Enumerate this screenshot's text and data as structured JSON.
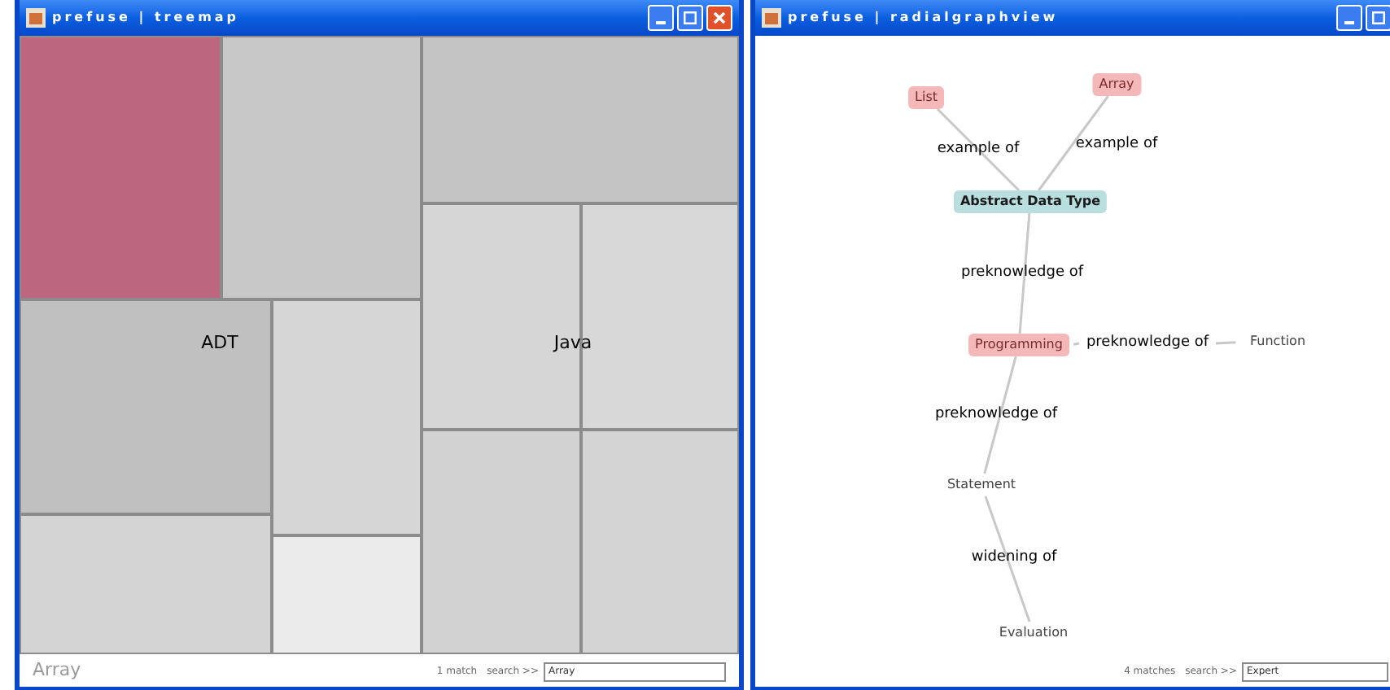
{
  "treemap_window": {
    "title": "prefuse | treemap",
    "cells": [
      {
        "color": "#bc6680"
      },
      {
        "color": "#c8c8c8"
      },
      {
        "color": "#c4c4c4"
      },
      {
        "color": "#c0c0c0"
      },
      {
        "color": "#d6d6d6"
      },
      {
        "color": "#d4d4d4"
      },
      {
        "color": "#ebebeb"
      },
      {
        "color": "#d6d6d6"
      },
      {
        "color": "#d8d8d8"
      },
      {
        "color": "#d2d2d2"
      },
      {
        "color": "#d4d4d4"
      }
    ],
    "group_labels": [
      "ADT",
      "Java"
    ],
    "status": {
      "hover_text": "Array",
      "match_count": "1 match",
      "search_label": "search >>",
      "search_value": "Array"
    }
  },
  "graph_window": {
    "title": "prefuse | radialgraphview",
    "nodes": [
      {
        "label": "List",
        "kind": "match"
      },
      {
        "label": "Array",
        "kind": "match"
      },
      {
        "label": "Abstract Data Type",
        "kind": "focus"
      },
      {
        "label": "Programming",
        "kind": "match"
      },
      {
        "label": "Function",
        "kind": "plain"
      },
      {
        "label": "Statement",
        "kind": "plain"
      },
      {
        "label": "Evaluation",
        "kind": "plain"
      }
    ],
    "edge_labels": [
      "example of",
      "example of",
      "preknowledge of",
      "preknowledge of",
      "preknowledge of",
      "widening of"
    ],
    "status": {
      "match_count": "4 matches",
      "search_label": "search >>",
      "search_value": "Expert"
    }
  }
}
